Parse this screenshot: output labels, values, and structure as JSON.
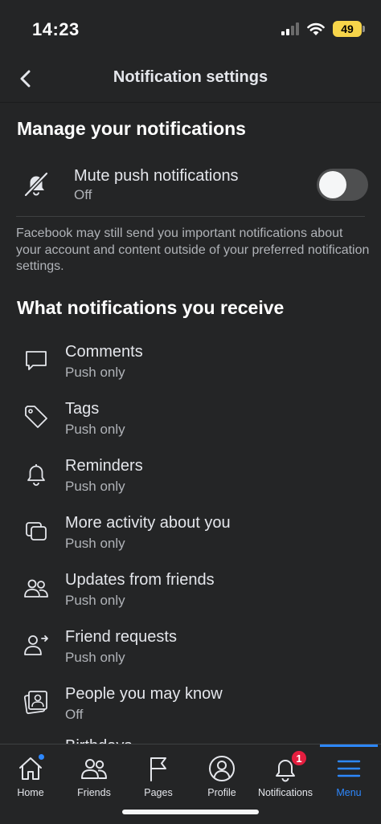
{
  "status_bar": {
    "time": "14:23",
    "battery": "49"
  },
  "header": {
    "title": "Notification settings"
  },
  "manage": {
    "title": "Manage your notifications",
    "mute_label": "Mute push notifications",
    "mute_status": "Off",
    "info": "Facebook may still send you important notifications about your account and content outside of your preferred notification settings."
  },
  "receive": {
    "title": "What notifications you receive",
    "items": [
      {
        "label": "Comments",
        "status": "Push only",
        "icon": "comment-icon"
      },
      {
        "label": "Tags",
        "status": "Push only",
        "icon": "tag-icon"
      },
      {
        "label": "Reminders",
        "status": "Push only",
        "icon": "bell-icon"
      },
      {
        "label": "More activity about you",
        "status": "Push only",
        "icon": "activity-icon"
      },
      {
        "label": "Updates from friends",
        "status": "Push only",
        "icon": "friends-icon"
      },
      {
        "label": "Friend requests",
        "status": "Push only",
        "icon": "friend-request-icon"
      },
      {
        "label": "People you may know",
        "status": "Off",
        "icon": "people-icon"
      }
    ],
    "peek_label": "Birthdays"
  },
  "nav": {
    "items": [
      {
        "label": "Home",
        "icon": "home-icon"
      },
      {
        "label": "Friends",
        "icon": "friends-icon"
      },
      {
        "label": "Pages",
        "icon": "flag-icon"
      },
      {
        "label": "Profile",
        "icon": "profile-icon"
      },
      {
        "label": "Notifications",
        "icon": "bell-icon",
        "badge": "1"
      },
      {
        "label": "Menu",
        "icon": "menu-icon"
      }
    ],
    "active": "Menu"
  },
  "colors": {
    "accent": "#2d88ff",
    "badge": "#e41e3f",
    "background": "#242526",
    "battery": "#f7d54a"
  }
}
